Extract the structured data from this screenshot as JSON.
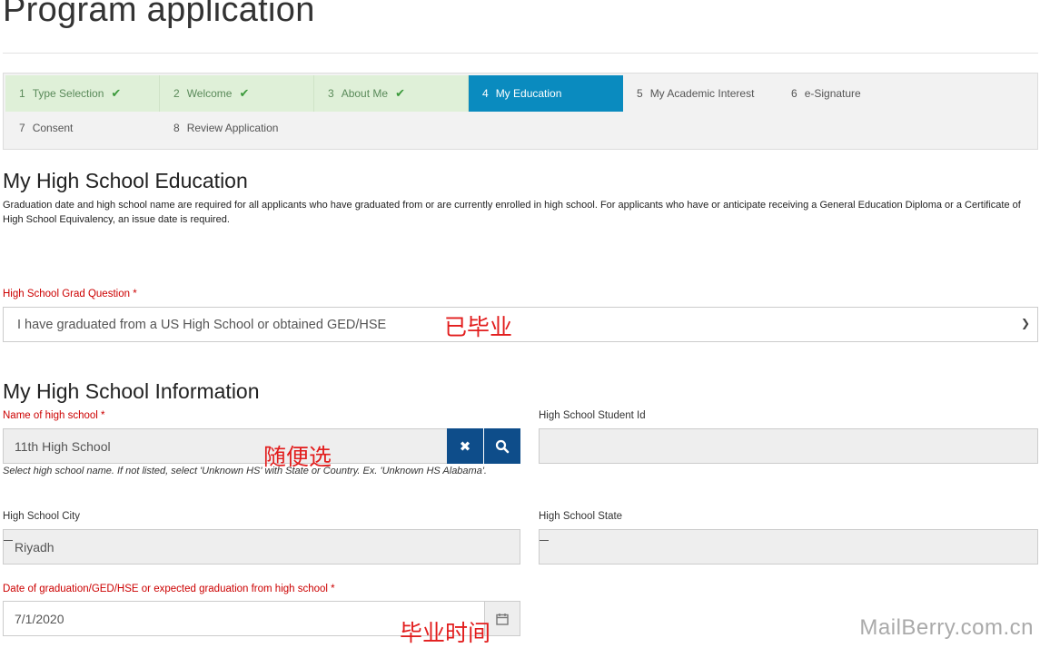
{
  "page": {
    "title": "Program application"
  },
  "steps": [
    {
      "num": "1",
      "label": "Type Selection",
      "state": "done"
    },
    {
      "num": "2",
      "label": "Welcome",
      "state": "done"
    },
    {
      "num": "3",
      "label": "About Me",
      "state": "done"
    },
    {
      "num": "4",
      "label": "My Education",
      "state": "active"
    },
    {
      "num": "5",
      "label": "My Academic Interest",
      "state": "pending"
    },
    {
      "num": "6",
      "label": "e-Signature",
      "state": "pending"
    },
    {
      "num": "7",
      "label": "Consent",
      "state": "pending"
    },
    {
      "num": "8",
      "label": "Review Application",
      "state": "pending"
    }
  ],
  "education": {
    "heading": "My High School Education",
    "description": "Graduation date and high school name are required for all applicants who have graduated from or are currently enrolled in high school. For applicants who have or anticipate receiving a General Education Diploma or a Certificate of High School Equivalency, an issue date is required.",
    "grad_question_label": "High School Grad Question *",
    "grad_question_value": "I have graduated from a US High School or obtained GED/HSE"
  },
  "info": {
    "heading": "My High School Information",
    "school_name_label": "Name of high school *",
    "school_name_value": "11th High School",
    "school_name_help": "Select high school name. If not listed, select 'Unknown HS' with State or Country. Ex. 'Unknown HS Alabama'.",
    "student_id_label": "High School Student Id",
    "student_id_value": "",
    "city_label": "High School City",
    "city_value": "Riyadh",
    "state_label": "High School State",
    "state_value": "",
    "grad_date_label": "Date of graduation/GED/HSE or expected graduation from high school *",
    "grad_date_value": "7/1/2020"
  },
  "annotations": {
    "graduated": "已毕业",
    "choose_any": "随便选",
    "grad_time": "毕业时间"
  },
  "watermark": "MailBerry.com.cn",
  "icons": {
    "check": "checkmark-icon",
    "clear": "close-icon",
    "search": "search-icon",
    "calendar": "calendar-icon",
    "caret": "chevron-down-icon"
  },
  "colors": {
    "active_step": "#0a8bbf",
    "done_step": "#dff0d8",
    "required": "#cc0000",
    "button": "#0e4d8a",
    "annotation": "#e21d1d"
  }
}
